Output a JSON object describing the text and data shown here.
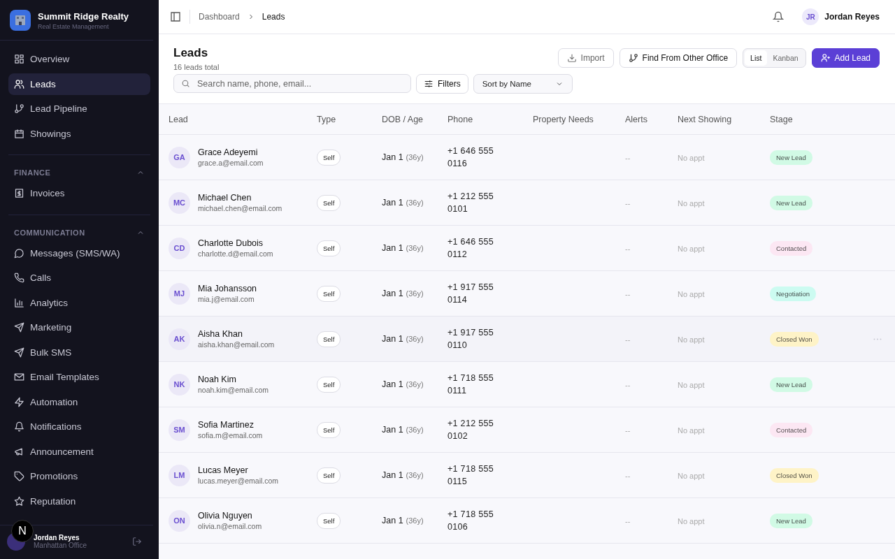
{
  "brand": {
    "name": "Summit Ridge Realty",
    "tagline": "Real Estate Management"
  },
  "nav_groups": [
    {
      "items": [
        {
          "label": "Overview",
          "selected": false
        },
        {
          "label": "Leads",
          "selected": true
        },
        {
          "label": "Lead Pipeline",
          "selected": false
        },
        {
          "label": "Showings",
          "selected": false
        }
      ]
    },
    {
      "title": "FINANCE",
      "expanded": true,
      "items": [
        {
          "label": "Invoices",
          "selected": false
        }
      ]
    },
    {
      "title": "COMMUNICATION",
      "expanded": true,
      "items": [
        {
          "label": "Messages (SMS/WA)",
          "selected": false
        },
        {
          "label": "Calls",
          "selected": false
        },
        {
          "label": "Analytics",
          "selected": false
        },
        {
          "label": "Marketing",
          "selected": false
        },
        {
          "label": "Bulk SMS",
          "selected": false
        },
        {
          "label": "Email Templates",
          "selected": false
        },
        {
          "label": "Automation",
          "selected": false
        },
        {
          "label": "Notifications",
          "selected": false
        },
        {
          "label": "Announcement",
          "selected": false
        },
        {
          "label": "Promotions",
          "selected": false
        },
        {
          "label": "Reputation",
          "selected": false
        }
      ]
    }
  ],
  "sidebar_user": {
    "name": "Jordan Reyes",
    "office": "Manhattan Office"
  },
  "dev_badge": "N",
  "breadcrumb": [
    "Dashboard",
    "Leads"
  ],
  "user": {
    "initials": "JR",
    "name": "Jordan Reyes"
  },
  "page": {
    "title": "Leads",
    "subtitle": "16 leads total"
  },
  "actions": {
    "import": "Import",
    "find": "Find From Other Office",
    "views": [
      {
        "label": "List",
        "selected": true
      },
      {
        "label": "Kanban",
        "selected": false
      }
    ],
    "add": "Add Lead"
  },
  "search": {
    "placeholder": "Search name, phone, email..."
  },
  "filters": "Filters",
  "sort": "Sort by Name",
  "columns": [
    "Lead",
    "Type",
    "DOB / Age",
    "Phone",
    "Property Needs",
    "Alerts",
    "Next Showing",
    "Stage"
  ],
  "rows": [
    {
      "initials": "GA",
      "name": "Grace Adeyemi",
      "email": "grace.a@email.com",
      "type": "Self",
      "dob": "Jan 1",
      "age": "(36y)",
      "phone": "+1 646 555 0116",
      "alerts": "--",
      "next": "No appt",
      "stage": {
        "label": "New Lead",
        "color": "#d1fae5"
      },
      "hovered": false
    },
    {
      "initials": "MC",
      "name": "Michael Chen",
      "email": "michael.chen@email.com",
      "type": "Self",
      "dob": "Jan 1",
      "age": "(36y)",
      "phone": "+1 212 555 0101",
      "alerts": "--",
      "next": "No appt",
      "stage": {
        "label": "New Lead",
        "color": "#d1fae5"
      },
      "hovered": false
    },
    {
      "initials": "CD",
      "name": "Charlotte Dubois",
      "email": "charlotte.d@email.com",
      "type": "Self",
      "dob": "Jan 1",
      "age": "(36y)",
      "phone": "+1 646 555 0112",
      "alerts": "--",
      "next": "No appt",
      "stage": {
        "label": "Contacted",
        "color": "#fce7f3"
      },
      "hovered": false
    },
    {
      "initials": "MJ",
      "name": "Mia Johansson",
      "email": "mia.j@email.com",
      "type": "Self",
      "dob": "Jan 1",
      "age": "(36y)",
      "phone": "+1 917 555 0114",
      "alerts": "--",
      "next": "No appt",
      "stage": {
        "label": "Negotiation",
        "color": "#ccfbf1"
      },
      "hovered": false
    },
    {
      "initials": "AK",
      "name": "Aisha Khan",
      "email": "aisha.khan@email.com",
      "type": "Self",
      "dob": "Jan 1",
      "age": "(36y)",
      "phone": "+1 917 555 0110",
      "alerts": "--",
      "next": "No appt",
      "stage": {
        "label": "Closed Won",
        "color": "#fef3c7"
      },
      "hovered": true
    },
    {
      "initials": "NK",
      "name": "Noah Kim",
      "email": "noah.kim@email.com",
      "type": "Self",
      "dob": "Jan 1",
      "age": "(36y)",
      "phone": "+1 718 555 0111",
      "alerts": "--",
      "next": "No appt",
      "stage": {
        "label": "New Lead",
        "color": "#d1fae5"
      },
      "hovered": false
    },
    {
      "initials": "SM",
      "name": "Sofia Martinez",
      "email": "sofia.m@email.com",
      "type": "Self",
      "dob": "Jan 1",
      "age": "(36y)",
      "phone": "+1 212 555 0102",
      "alerts": "--",
      "next": "No appt",
      "stage": {
        "label": "Contacted",
        "color": "#fce7f3"
      },
      "hovered": false
    },
    {
      "initials": "LM",
      "name": "Lucas Meyer",
      "email": "lucas.meyer@email.com",
      "type": "Self",
      "dob": "Jan 1",
      "age": "(36y)",
      "phone": "+1 718 555 0115",
      "alerts": "--",
      "next": "No appt",
      "stage": {
        "label": "Closed Won",
        "color": "#fef3c7"
      },
      "hovered": false
    },
    {
      "initials": "ON",
      "name": "Olivia Nguyen",
      "email": "olivia.n@email.com",
      "type": "Self",
      "dob": "Jan 1",
      "age": "(36y)",
      "phone": "+1 718 555 0106",
      "alerts": "--",
      "next": "No appt",
      "stage": {
        "label": "New Lead",
        "color": "#d1fae5"
      },
      "hovered": false
    }
  ]
}
